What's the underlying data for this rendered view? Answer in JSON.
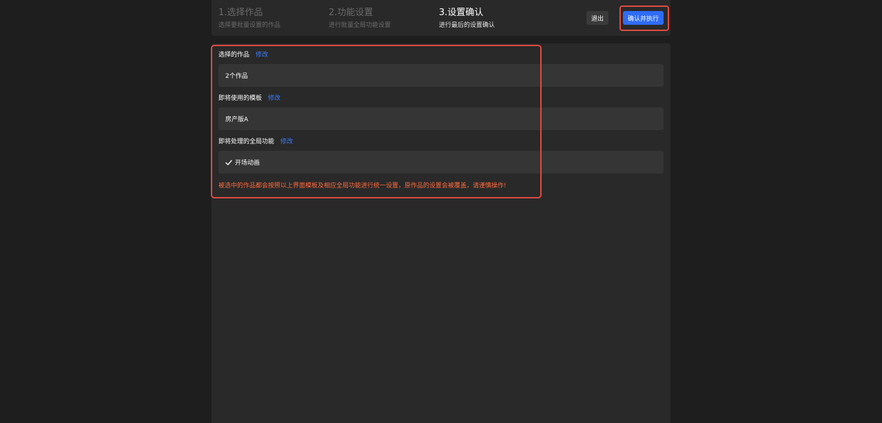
{
  "steps": [
    {
      "title": "1.选择作品",
      "subtitle": "选择要批量设置的作品",
      "state": "inactive"
    },
    {
      "title": "2.功能设置",
      "subtitle": "进行批量全局功能设置",
      "state": "inactive"
    },
    {
      "title": "3.设置确认",
      "subtitle": "进行最后的设置确认",
      "state": "active"
    }
  ],
  "header": {
    "exit_label": "退出",
    "confirm_label": "确认并执行"
  },
  "sections": {
    "works": {
      "label": "选择的作品",
      "edit_label": "修改",
      "value": "2个作品"
    },
    "template": {
      "label": "即将使用的模板",
      "edit_label": "修改",
      "value": "房产版A"
    },
    "features": {
      "label": "即将处理的全局功能",
      "edit_label": "修改",
      "items": [
        "开场动画"
      ],
      "check_icon": "check-icon"
    }
  },
  "warning": "被选中的作品都会按照以上界面模板及相应全局功能进行统一设置，原作品的设置会被覆盖，请谨慎操作!",
  "colors": {
    "accent": "#2e6cf3",
    "link": "#3b7cff",
    "warning": "#ff6a3d",
    "highlight": "#e04b40"
  }
}
